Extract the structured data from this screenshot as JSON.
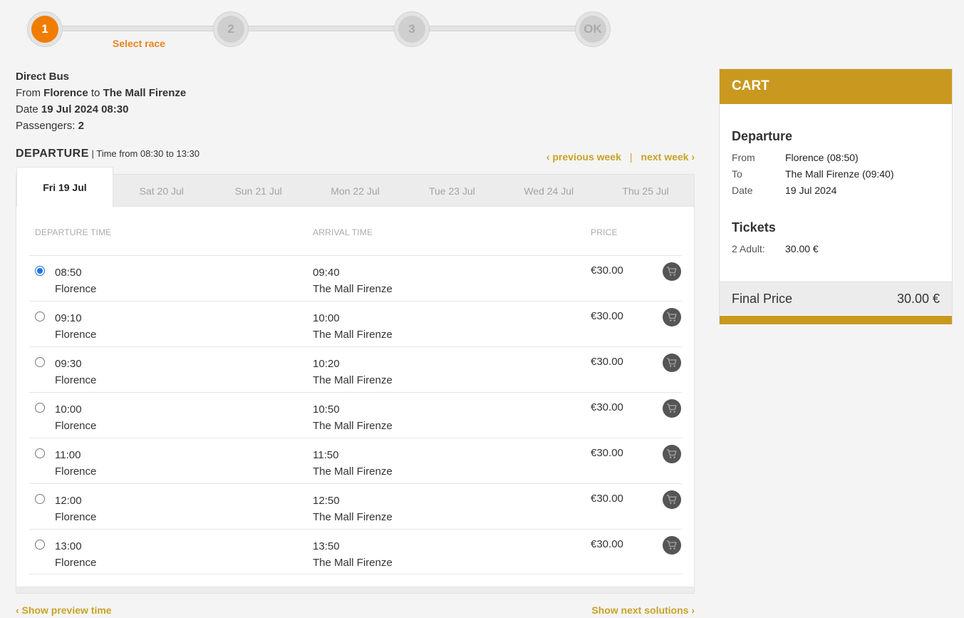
{
  "stepper": {
    "steps": [
      "1",
      "2",
      "3",
      "OK"
    ],
    "active_label": "Select race"
  },
  "trip": {
    "type": "Direct Bus",
    "from_label": "From",
    "from": "Florence",
    "to_label": "to",
    "to": "The Mall Firenze",
    "date_label": "Date",
    "date": "19 Jul 2024 08:30",
    "passengers_label": "Passengers:",
    "passengers": "2"
  },
  "departure": {
    "title": "DEPARTURE",
    "time_range": "| Time from 08:30 to 13:30",
    "previous_week": "‹ previous week",
    "separator": "|",
    "next_week": "next week ›"
  },
  "tabs": [
    "Fri 19 Jul",
    "Sat 20 Jul",
    "Sun 21 Jul",
    "Mon 22 Jul",
    "Tue 23 Jul",
    "Wed 24 Jul",
    "Thu 25 Jul"
  ],
  "columns": {
    "departure": "DEPARTURE TIME",
    "arrival": "ARRIVAL TIME",
    "price": "PRICE"
  },
  "rides": [
    {
      "dep_time": "08:50",
      "dep_place": "Florence",
      "arr_time": "09:40",
      "arr_place": "The Mall Firenze",
      "price": "€30.00",
      "selected": true
    },
    {
      "dep_time": "09:10",
      "dep_place": "Florence",
      "arr_time": "10:00",
      "arr_place": "The Mall Firenze",
      "price": "€30.00",
      "selected": false
    },
    {
      "dep_time": "09:30",
      "dep_place": "Florence",
      "arr_time": "10:20",
      "arr_place": "The Mall Firenze",
      "price": "€30.00",
      "selected": false
    },
    {
      "dep_time": "10:00",
      "dep_place": "Florence",
      "arr_time": "10:50",
      "arr_place": "The Mall Firenze",
      "price": "€30.00",
      "selected": false
    },
    {
      "dep_time": "11:00",
      "dep_place": "Florence",
      "arr_time": "11:50",
      "arr_place": "The Mall Firenze",
      "price": "€30.00",
      "selected": false
    },
    {
      "dep_time": "12:00",
      "dep_place": "Florence",
      "arr_time": "12:50",
      "arr_place": "The Mall Firenze",
      "price": "€30.00",
      "selected": false
    },
    {
      "dep_time": "13:00",
      "dep_place": "Florence",
      "arr_time": "13:50",
      "arr_place": "The Mall Firenze",
      "price": "€30.00",
      "selected": false
    }
  ],
  "bottom_nav": {
    "prev": "‹ Show preview time",
    "next": "Show next solutions ›"
  },
  "cart": {
    "title": "CART",
    "departure_title": "Departure",
    "from_label": "From",
    "from_value": "Florence (08:50)",
    "to_label": "To",
    "to_value": "The Mall Firenze (09:40)",
    "date_label": "Date",
    "date_value": "19 Jul 2024",
    "tickets_title": "Tickets",
    "ticket_label": "2 Adult:",
    "ticket_value": "30.00 €",
    "final_label": "Final Price",
    "final_value": "30.00 €"
  },
  "colors": {
    "accent_orange": "#f07d00",
    "gold": "#c9991f",
    "link_gold": "#c9a227"
  },
  "icons": {
    "cart": "shopping-cart-icon"
  }
}
